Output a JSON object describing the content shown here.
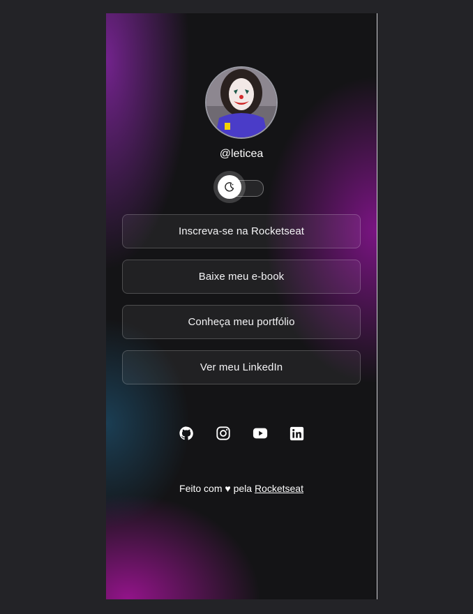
{
  "profile": {
    "username": "@leticea",
    "avatar_alt": "avatar"
  },
  "theme_toggle": {
    "icon": "moon-icon",
    "state": "off"
  },
  "links": [
    {
      "label": "Inscreva-se na Rocketseat"
    },
    {
      "label": "Baixe meu e-book"
    },
    {
      "label": "Conheça meu portfólio"
    },
    {
      "label": "Ver meu LinkedIn"
    }
  ],
  "socials": [
    {
      "icon": "github-icon"
    },
    {
      "icon": "instagram-icon"
    },
    {
      "icon": "youtube-icon"
    },
    {
      "icon": "linkedin-icon"
    }
  ],
  "footer": {
    "prefix": "Feito com ♥ pela ",
    "link_label": "Rocketseat"
  },
  "colors": {
    "page_bg": "#232327",
    "accent_purple": "#8c1496",
    "text": "#ffffff"
  }
}
